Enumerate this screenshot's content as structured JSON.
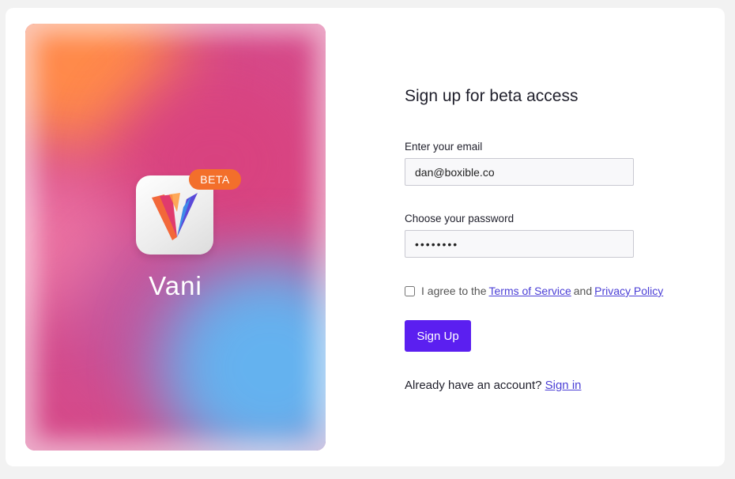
{
  "hero": {
    "app_name": "Vani",
    "badge": "BETA",
    "icon": "vani-logo-icon",
    "colors": {
      "orange": "#ff8a4a",
      "pink": "#d9427f",
      "blue": "#64b2ef",
      "badge": "#f36f2b"
    }
  },
  "form": {
    "title": "Sign up for beta access",
    "email_label": "Enter your email",
    "email_value": "dan@boxible.co",
    "password_label": "Choose your password",
    "password_value": "••••••••",
    "agree_prefix": "I agree to the",
    "terms_link": "Terms of Service",
    "agree_and": "and",
    "privacy_link": "Privacy Policy",
    "submit_label": "Sign Up",
    "signin_prompt": "Already have an account?",
    "signin_link": "Sign in",
    "accent_color": "#5b1ff0"
  }
}
